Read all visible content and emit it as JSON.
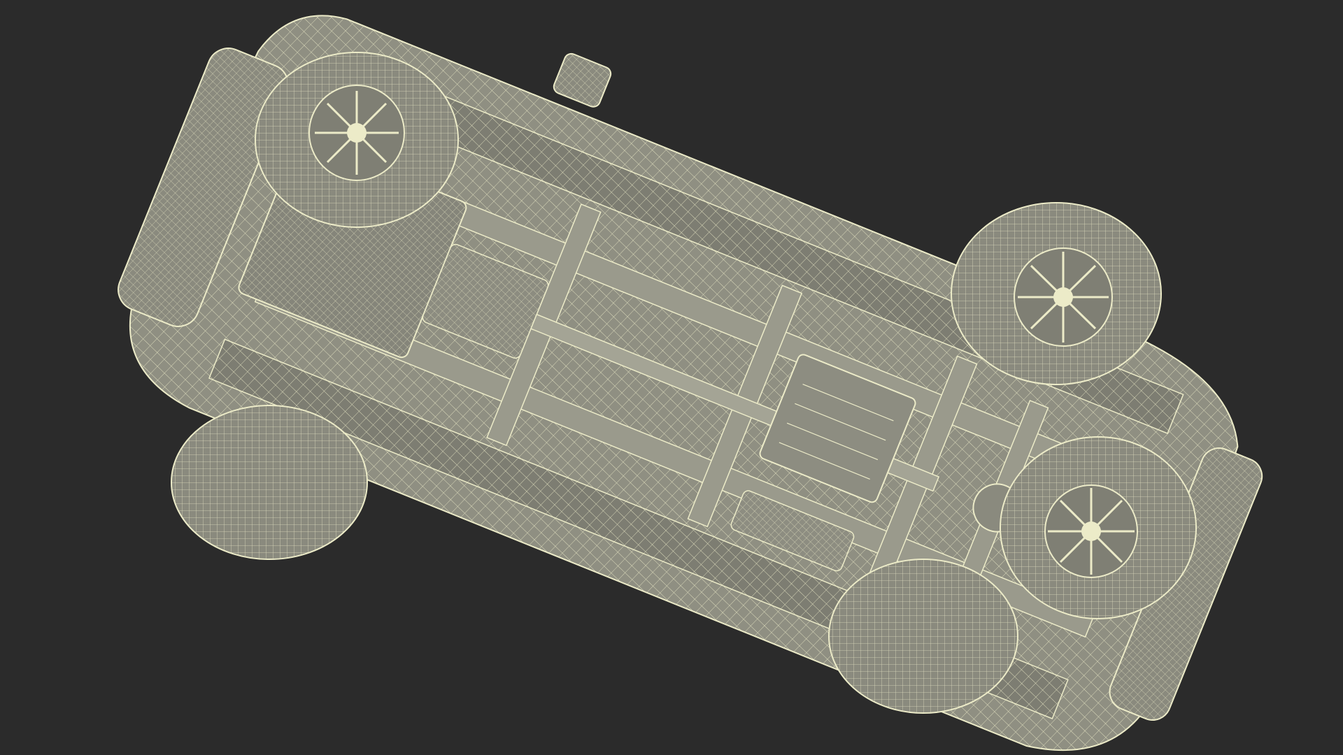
{
  "scene": {
    "background_color": "#2b2b2b",
    "mesh_fill_color": "#8f8f82",
    "mesh_fill_dark": "#6f6f64",
    "wire_color": "#ecebc8",
    "subject": "wireframe-vehicle-underside-view"
  }
}
